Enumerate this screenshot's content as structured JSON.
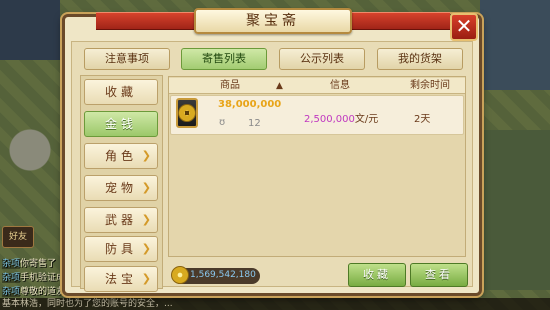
{
  "window": {
    "title": "聚宝斋",
    "close_label": "✕"
  },
  "tabs": [
    {
      "label": "注意事项",
      "active": false
    },
    {
      "label": "寄售列表",
      "active": true
    },
    {
      "label": "公示列表",
      "active": false
    },
    {
      "label": "我的货架",
      "active": false
    }
  ],
  "categories": [
    {
      "label": "收藏",
      "active": false,
      "expandable": false
    },
    {
      "label": "金钱",
      "active": true,
      "expandable": false
    },
    {
      "label": "角色",
      "active": false,
      "expandable": true
    },
    {
      "label": "宠物",
      "active": false,
      "expandable": true
    },
    {
      "label": "武器",
      "active": false,
      "expandable": true
    },
    {
      "label": "防具",
      "active": false,
      "expandable": true
    },
    {
      "label": "法宝",
      "active": false,
      "expandable": true
    }
  ],
  "table": {
    "headers": {
      "item": "商品",
      "info": "信息",
      "time": "剩余时间"
    },
    "sort_indicator": "▲",
    "rows": [
      {
        "amount": "38,000,000",
        "seller_icon": "ʊ",
        "count": "12",
        "price": "2,500,000",
        "price_unit": "文/元",
        "time": "2天"
      }
    ]
  },
  "footer": {
    "gold": "1,569,542,180",
    "favorite_label": "收藏",
    "view_label": "查看"
  },
  "chat": {
    "friend_button": "好友",
    "lines": [
      {
        "channel": "杂项",
        "text": "你寄售了"
      },
      {
        "channel": "杂项",
        "text": "手机验证成"
      },
      {
        "channel": "杂项",
        "text": "尊敬的道友"
      }
    ],
    "bottom_text": "基本林浩，同时也为了您的账号的安全，..."
  },
  "colors": {
    "accent_green": "#9cc86a",
    "title_red": "#c3321f",
    "gold": "#e8a418",
    "price_purple": "#c038c0"
  }
}
